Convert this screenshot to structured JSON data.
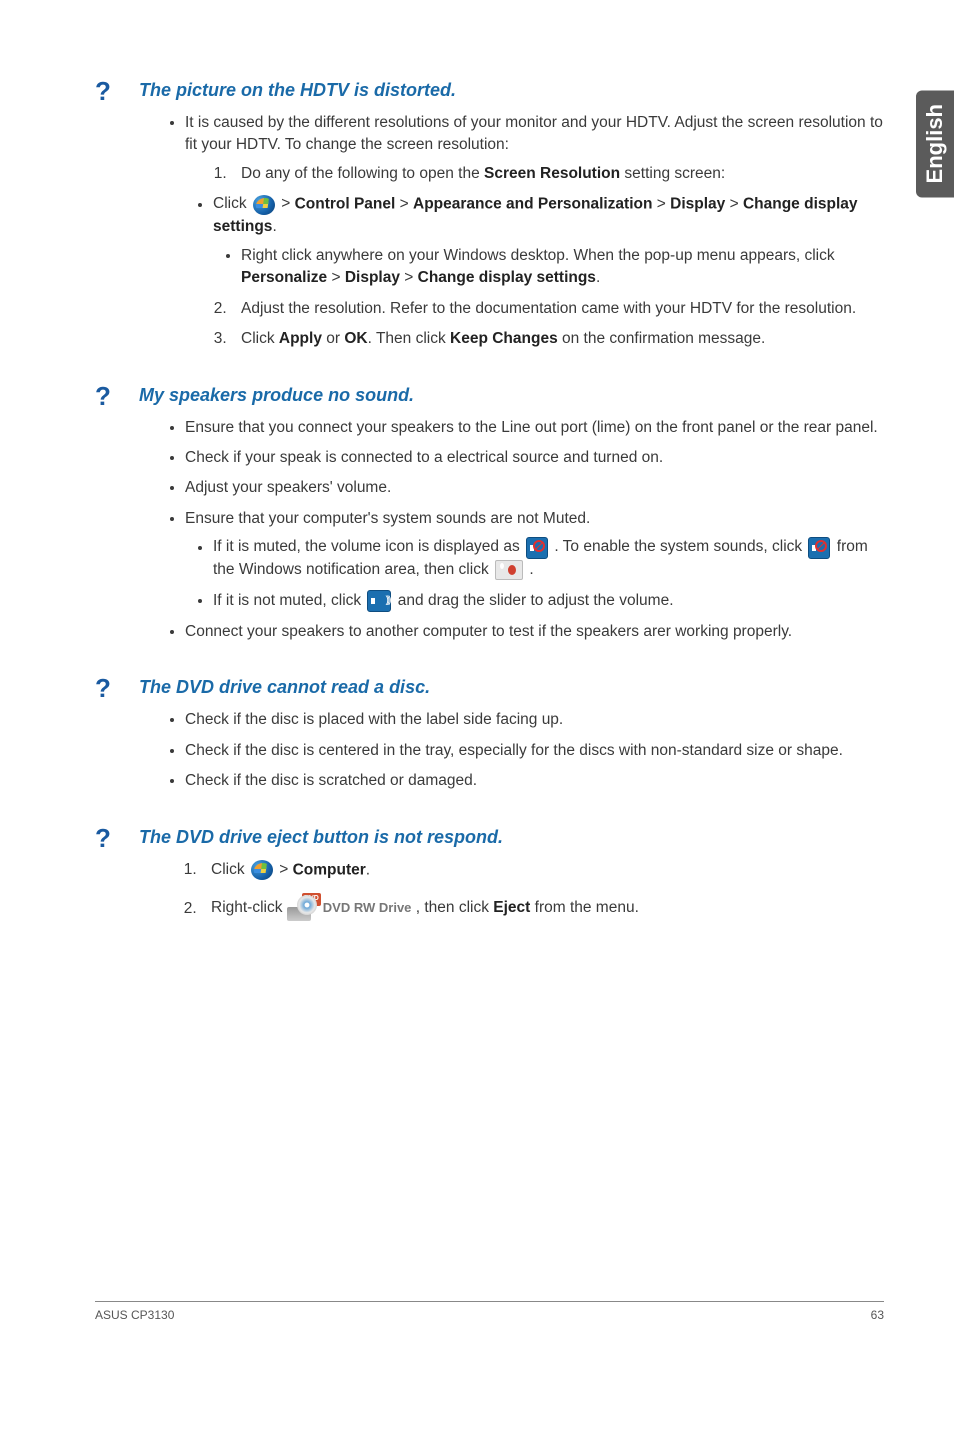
{
  "lang_tab": "English",
  "q1": {
    "title": "The picture on the HDTV is distorted.",
    "intro": "It is caused by the different resolutions of your monitor and your HDTV. Adjust the screen resolution to fit your HDTV. To change the screen resolution:",
    "step1_pre": "Do any of the following to open the ",
    "step1_bold": "Screen Resolution",
    "step1_post": " setting screen:",
    "click_label": "Click ",
    "path_gt1": " > ",
    "path_b1": "Control Panel",
    "path_b2": "Appearance and Personalization",
    "path_b3": "Display",
    "path_b4": "Change display settings",
    "sub_a": "Right click anywhere on your Windows desktop. When the pop-up menu appears, click ",
    "sub_a_b1": "Personalize",
    "sub_a_b2": "Display",
    "sub_a_b3": "Change display settings",
    "step2": "Adjust the resolution. Refer to the documentation came with your HDTV for the resolution.",
    "step3_pre": "Click ",
    "step3_b1": "Apply",
    "step3_mid": " or ",
    "step3_b2": "OK",
    "step3_mid2": ". Then click ",
    "step3_b3": "Keep Changes",
    "step3_post": " on the confirmation message."
  },
  "q2": {
    "title": "My speakers produce no sound.",
    "b1": "Ensure that you connect your speakers to the Line out port (lime) on the front panel or the rear panel.",
    "b2": "Check if your speak is connected to a electrical source and turned on.",
    "b3": "Adjust your speakers' volume.",
    "b4": "Ensure that your computer's system sounds are not Muted.",
    "b4a_pre": "If it is muted, the volume icon is displayed as ",
    "b4a_mid": " . To enable the system sounds, click ",
    "b4a_mid2": " from the Windows notification area, then click ",
    "b4a_post": " .",
    "b4b_pre": "If it is not muted, click ",
    "b4b_post": " and drag the slider to adjust the volume.",
    "b5": "Connect your speakers to another computer to test if the speakers arer working properly."
  },
  "q3": {
    "title": "The DVD drive cannot read a disc.",
    "b1": "Check if the disc is placed with the label side facing up.",
    "b2": "Check if the disc is centered in the tray, especially for the discs with non-standard size or shape.",
    "b3": "Check if the disc is scratched or damaged."
  },
  "q4": {
    "title": "The DVD drive eject button is not respond.",
    "s1_pre": "Click ",
    "s1_gt": " > ",
    "s1_b": "Computer",
    "s2_pre": "Right-click ",
    "s2_mid": " , then click ",
    "s2_b": "Eject",
    "s2_post": " from the menu.",
    "dvd_label": "DVD RW Drive",
    "dvd_badge": "DVD"
  },
  "footer_left": "ASUS CP3130",
  "footer_right": "63"
}
